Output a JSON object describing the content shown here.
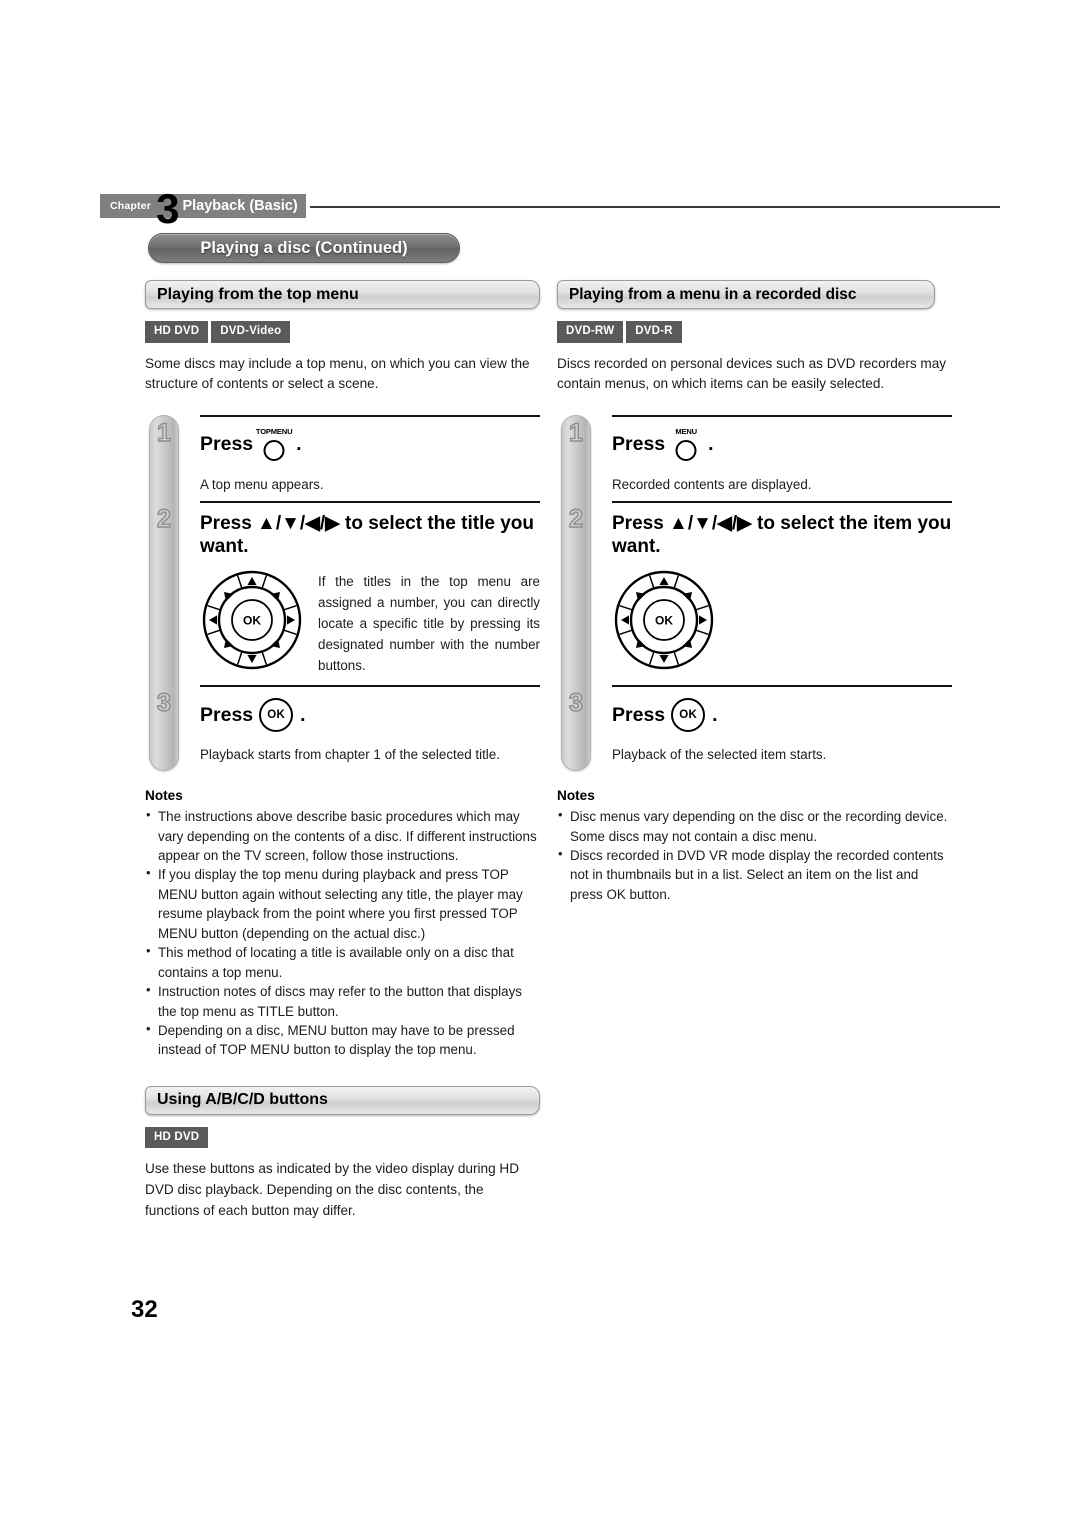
{
  "chapter": {
    "label": "Chapter",
    "number": "3",
    "title": "Playback (Basic)"
  },
  "page_title": "Playing a disc (Continued)",
  "page_number": "32",
  "sections": {
    "top_menu": {
      "heading": "Playing from the top menu",
      "badges": [
        "HD DVD",
        "DVD-Video"
      ],
      "intro": "Some discs may include a top menu, on which you can view the structure of contents or select a scene.",
      "steps": [
        {
          "num": "1",
          "press_word": "Press",
          "button_cap": "TOPMENU",
          "button_kind": "circle",
          "sub": "A top menu appears."
        },
        {
          "num": "2",
          "heading": "Press ▲/▼/◀/▶ to select the title you want.",
          "dpad_ok": "OK",
          "dpad_text": "If the titles in the top menu are assigned a number, you can directly locate a specific title by pressing its designated number with the number buttons."
        },
        {
          "num": "3",
          "press_word": "Press",
          "button_cap": "OK",
          "button_kind": "ok",
          "sub": "Playback starts from chapter 1 of the selected title."
        }
      ],
      "notes_title": "Notes",
      "notes": [
        "The instructions above describe basic procedures which may vary depending on the contents of a disc. If different instructions appear on the TV screen, follow those instructions.",
        "If you display the top menu during playback and press TOP MENU button again without selecting any title, the player may resume playback from the point where you first pressed TOP MENU button (depending on the actual disc.)",
        "This method of locating a title is available only on a disc that contains a top menu.",
        "Instruction notes of discs may refer to the button that displays the top menu as TITLE button.",
        "Depending on a disc, MENU button may have to be pressed instead of TOP MENU button to display the top menu."
      ]
    },
    "recorded_menu": {
      "heading": "Playing from a menu in a recorded disc",
      "badges": [
        "DVD-RW",
        "DVD-R"
      ],
      "intro": "Discs recorded on personal devices such as DVD recorders may contain menus, on which items can be easily selected.",
      "steps": [
        {
          "num": "1",
          "press_word": "Press",
          "button_cap": "MENU",
          "button_kind": "circle",
          "sub": "Recorded contents are displayed."
        },
        {
          "num": "2",
          "heading": "Press ▲/▼/◀/▶ to select the item you want.",
          "dpad_ok": "OK",
          "dpad_text": ""
        },
        {
          "num": "3",
          "press_word": "Press",
          "button_cap": "OK",
          "button_kind": "ok",
          "sub": "Playback of the selected item starts."
        }
      ],
      "notes_title": "Notes",
      "notes": [
        "Disc menus vary depending on the disc or the recording device. Some discs may not contain a disc menu.",
        "Discs recorded in DVD VR mode display the recorded contents not in thumbnails but in a list. Select an item on the list and press OK button."
      ]
    },
    "abcd": {
      "heading": "Using A/B/C/D buttons",
      "badges": [
        "HD DVD"
      ],
      "intro": "Use these buttons as indicated by the video display during HD DVD disc playback. Depending on the disc contents, the functions of each button may differ."
    }
  }
}
